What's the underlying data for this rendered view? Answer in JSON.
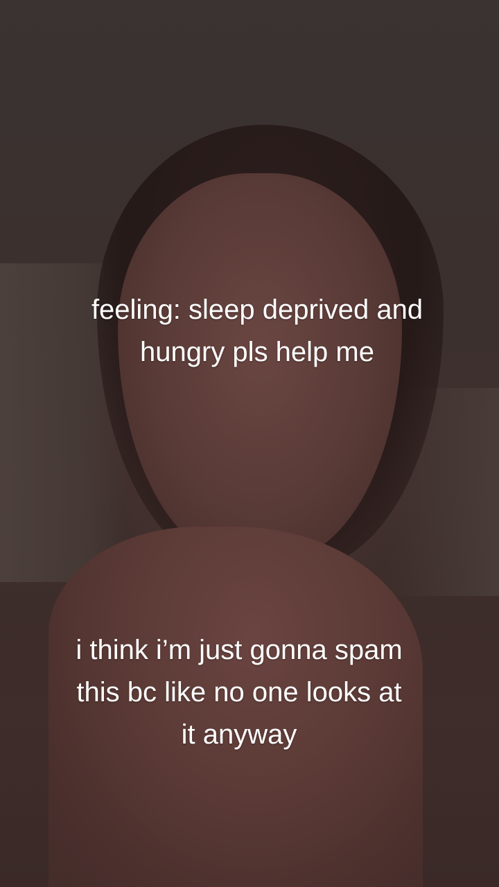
{
  "captions": {
    "top": "feeling: sleep deprived and\nhungry pls help me",
    "bottom": "i think i’m just gonna spam\nthis bc like no one looks at\nit anyway"
  }
}
